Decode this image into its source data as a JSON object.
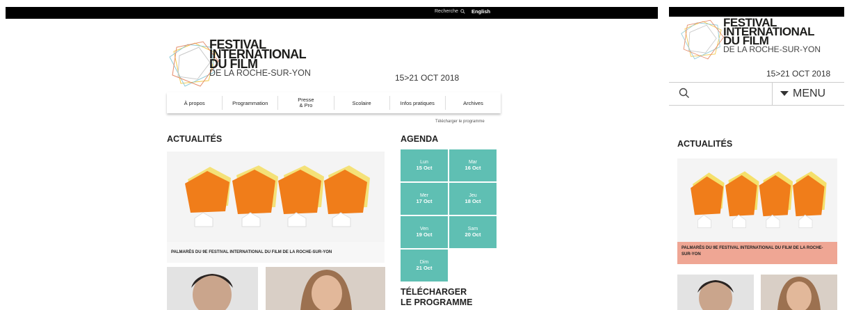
{
  "topbar": {
    "search_label": "Recherche",
    "language": "English"
  },
  "festival": {
    "line1": "FESTIVAL",
    "line2": "INTERNATIONAL",
    "line3": "DU FILM",
    "line4": "DE LA ROCHE-SUR-YON",
    "dates": "15>21 OCT 2018"
  },
  "nav": [
    {
      "label": "À propos"
    },
    {
      "label": "Programmation"
    },
    {
      "label": "Presse\n& Pro"
    },
    {
      "label": "Scolaire"
    },
    {
      "label": "Infos pratiques"
    },
    {
      "label": "Archives"
    }
  ],
  "download_link": "Télécharger le programme",
  "news": {
    "heading": "ACTUALITÉS",
    "caption": "PALMARÈS DU 9E FESTIVAL INTERNATIONAL DU FILM DE LA ROCHE-SUR-YON"
  },
  "agenda": {
    "heading": "AGENDA",
    "days": [
      {
        "day": "Lun",
        "date": "15 Oct"
      },
      {
        "day": "Mar",
        "date": "16 Oct"
      },
      {
        "day": "Mer",
        "date": "17 Oct"
      },
      {
        "day": "Jeu",
        "date": "18 Oct"
      },
      {
        "day": "Ven",
        "date": "19 Oct"
      },
      {
        "day": "Sam",
        "date": "20 Oct"
      },
      {
        "day": "Dim",
        "date": "21 Oct"
      }
    ]
  },
  "program": {
    "line1": "TÉLÉCHARGER",
    "line2": "LE PROGRAMME"
  },
  "mobile": {
    "menu_label": "MENU"
  },
  "colors": {
    "agenda": "#5fbfb3",
    "caption_mobile": "#efa694",
    "trophy": "#f07d1a"
  }
}
